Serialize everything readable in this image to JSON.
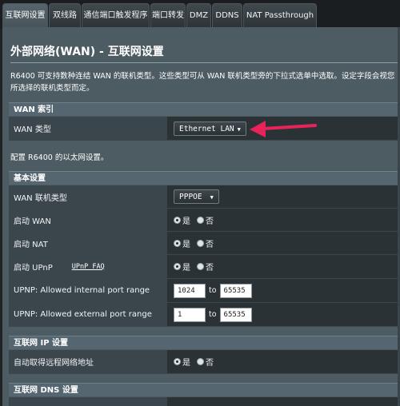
{
  "tabs": [
    "互联网设置",
    "双线路",
    "通信端口触发程序",
    "端口转发",
    "DMZ",
    "DDNS",
    "NAT Passthrough"
  ],
  "page_title": "外部网络(WAN) - 互联网设置",
  "description": "R6400 可支持数种连结 WAN 的联机类型。这些类型可从 WAN 联机类型旁的下拉式选单中选取。设定字段会视您所选择的联机类型而定。",
  "wan_index": {
    "header": "WAN 索引",
    "wan_type_label": "WAN 类型",
    "wan_type_value": "Ethernet LAN"
  },
  "ethernet_note": "配置 R6400 的以太网设置。",
  "basic": {
    "header": "基本设置",
    "conn_type_label": "WAN 联机类型",
    "conn_type_value": "PPPOE",
    "enable_wan_label": "启动 WAN",
    "enable_nat_label": "启动 NAT",
    "enable_upnp_label": "启动 UPnP",
    "upnp_faq": "UPnP FAQ",
    "internal_label": "UPNP: Allowed internal port range",
    "internal_from": "1024",
    "internal_to": "65535",
    "external_label": "UPNP: Allowed external port range",
    "external_from": "1",
    "external_to": "65535",
    "to_label": "to"
  },
  "ip": {
    "header": "互联网 IP 设置",
    "auto_ip_label": "自动取得远程网络地址"
  },
  "dns": {
    "header": "互联网 DNS 设置"
  },
  "radio": {
    "yes": "是",
    "no": "否"
  },
  "colors": {
    "arrow": "#e8235a"
  }
}
